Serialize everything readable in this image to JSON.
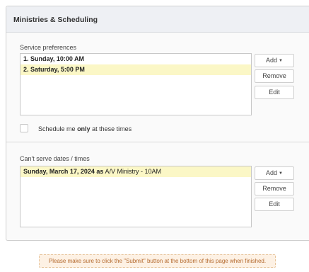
{
  "panel": {
    "title": "Ministries & Scheduling"
  },
  "service_preferences": {
    "label": "Service preferences",
    "items": [
      {
        "text": "1. Sunday, 10:00 AM",
        "selected": false
      },
      {
        "text": "2. Saturday, 5:00 PM",
        "selected": true
      }
    ],
    "buttons": {
      "add": "Add",
      "remove": "Remove",
      "edit": "Edit"
    },
    "checkbox": {
      "checked": false,
      "label_before": "Schedule me",
      "label_bold": "only",
      "label_after": "at these times"
    }
  },
  "cant_serve": {
    "label": "Can't serve dates / times",
    "items": [
      {
        "date": "Sunday, March 17, 2024",
        "as": "as",
        "ministry": "A/V Ministry - 10AM",
        "selected": true
      }
    ],
    "buttons": {
      "add": "Add",
      "remove": "Remove",
      "edit": "Edit"
    }
  },
  "notice": {
    "text": "Please make sure to click the \"Submit\" button at the bottom of this page when finished."
  },
  "colors": {
    "header_bg": "#eef0f4",
    "selected_row": "#fbf7c6",
    "notice_bg": "#fdf1e4",
    "notice_text": "#b46a2f"
  }
}
